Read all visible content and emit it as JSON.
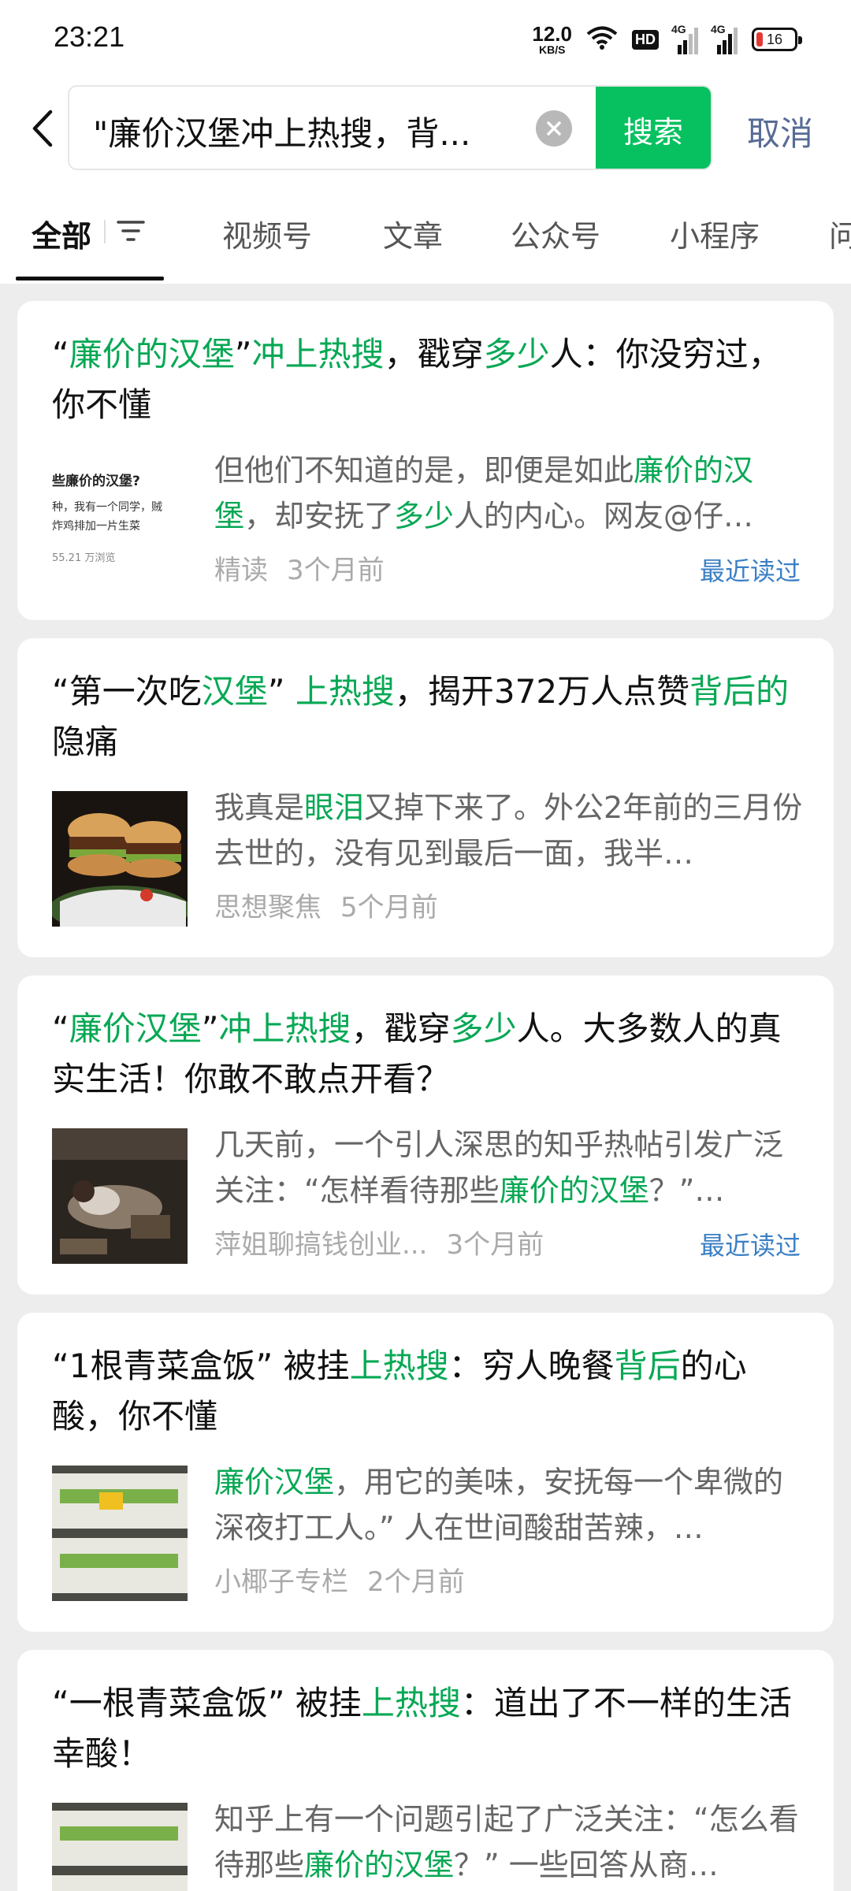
{
  "status_bar": {
    "time": "23:21",
    "net_speed_value": "12.0",
    "net_speed_unit": "KB/S",
    "hd_label": "HD",
    "signal1_label": "4G",
    "signal2_label": "4G",
    "battery_level": "16",
    "icons": [
      "wifi-icon",
      "hd-icon",
      "signal-icon",
      "battery-icon"
    ]
  },
  "search": {
    "query": "\"廉价汉堡冲上热搜，背...",
    "search_button": "搜索",
    "cancel": "取消"
  },
  "tabs": [
    "全部",
    "视频号",
    "文章",
    "公众号",
    "小程序",
    "问"
  ],
  "active_tab": "全部",
  "colors": {
    "accent": "#07c160",
    "highlight": "#07a854",
    "link": "#576b95",
    "recent": "#3b7fc4"
  },
  "results": [
    {
      "title_parts": [
        {
          "t": "“",
          "h": false
        },
        {
          "t": "廉价的汉堡",
          "h": true
        },
        {
          "t": "”",
          "h": false
        },
        {
          "t": "冲上热搜",
          "h": true
        },
        {
          "t": "，戳穿",
          "h": false
        },
        {
          "t": "多少",
          "h": true
        },
        {
          "t": "人：你没穷过，你不懂",
          "h": false
        }
      ],
      "thumb_lines": [
        "些廉价的汉堡?",
        "种，我有一个同学，贼",
        "炸鸡排加一片生菜",
        "55.21 万浏览"
      ],
      "snippet_parts": [
        {
          "t": "但他们不知道的是，即便是如此",
          "h": false
        },
        {
          "t": "廉价的汉堡",
          "h": true
        },
        {
          "t": "，却安抚了",
          "h": false
        },
        {
          "t": "多少",
          "h": true
        },
        {
          "t": "人的内心。网友@仔…",
          "h": false
        }
      ],
      "source": "精读",
      "time": "3个月前",
      "badge": "最近读过"
    },
    {
      "title_parts": [
        {
          "t": "“第一次吃",
          "h": false
        },
        {
          "t": "汉堡",
          "h": true
        },
        {
          "t": "” ",
          "h": false
        },
        {
          "t": "上热搜",
          "h": true
        },
        {
          "t": "，揭开372万人点赞",
          "h": false
        },
        {
          "t": "背后的",
          "h": true
        },
        {
          "t": "隐痛",
          "h": false
        }
      ],
      "snippet_parts": [
        {
          "t": "我真是",
          "h": false
        },
        {
          "t": "眼泪",
          "h": true
        },
        {
          "t": "又掉下来了。外公2年前的三月份去世的，没有见到最后一面，我半…",
          "h": false
        }
      ],
      "source": "思想聚焦",
      "time": "5个月前",
      "badge": ""
    },
    {
      "title_parts": [
        {
          "t": "“",
          "h": false
        },
        {
          "t": "廉价汉堡",
          "h": true
        },
        {
          "t": "”",
          "h": false
        },
        {
          "t": "冲上热搜",
          "h": true
        },
        {
          "t": "，戳穿",
          "h": false
        },
        {
          "t": "多少",
          "h": true
        },
        {
          "t": "人。大多数人的真实生活！你敢不敢点开看？",
          "h": false
        }
      ],
      "snippet_parts": [
        {
          "t": "几天前，一个引人深思的知乎热帖引发广泛关注：“怎样看待那些",
          "h": false
        },
        {
          "t": "廉价的汉堡",
          "h": true
        },
        {
          "t": "？”…",
          "h": false
        }
      ],
      "source": "萍姐聊搞钱创业...",
      "time": "3个月前",
      "badge": "最近读过"
    },
    {
      "title_parts": [
        {
          "t": "“1根青菜盒饭” 被挂",
          "h": false
        },
        {
          "t": "上热搜",
          "h": true
        },
        {
          "t": "：穷人晚餐",
          "h": false
        },
        {
          "t": "背后",
          "h": true
        },
        {
          "t": "的心酸，你不懂",
          "h": false
        }
      ],
      "snippet_parts": [
        {
          "t": "廉价汉堡",
          "h": true
        },
        {
          "t": "，用它的美味，安抚每一个卑微的深夜打工人。” 人在世间酸甜苦辣，…",
          "h": false
        }
      ],
      "source": "小椰子专栏",
      "time": "2个月前",
      "badge": ""
    },
    {
      "title_parts": [
        {
          "t": "“一根青菜盒饭” 被挂",
          "h": false
        },
        {
          "t": "上热搜",
          "h": true
        },
        {
          "t": "：道出了不一样的生活幸酸！",
          "h": false
        }
      ],
      "snippet_parts": [
        {
          "t": "知乎上有一个问题引起了广泛关注：“怎么看待那些",
          "h": false
        },
        {
          "t": "廉价的汉堡",
          "h": true
        },
        {
          "t": "？” 一些回答从商…",
          "h": false
        }
      ],
      "source": "",
      "time": "",
      "badge": ""
    }
  ]
}
